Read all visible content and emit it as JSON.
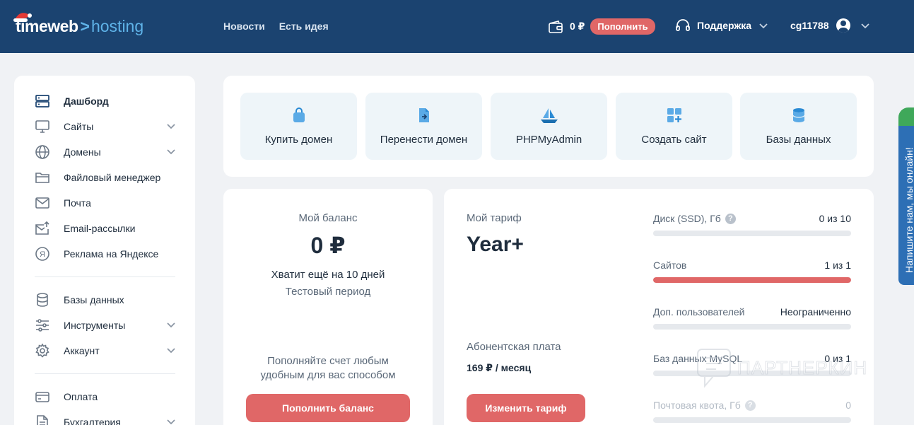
{
  "header": {
    "logo": {
      "brand": "timeweb",
      "separator": ">",
      "product": "hosting"
    },
    "nav": [
      "Новости",
      "Есть идея"
    ],
    "wallet": {
      "balance": "0 ₽",
      "topup_label": "Пополнить"
    },
    "support_label": "Поддержка",
    "username": "cg11788"
  },
  "sidebar": {
    "items": [
      {
        "label": "Дашборд",
        "icon": "server-icon",
        "active": true
      },
      {
        "label": "Сайты",
        "icon": "monitor-icon",
        "expandable": true
      },
      {
        "label": "Домены",
        "icon": "globe-icon",
        "expandable": true
      },
      {
        "label": "Файловый менеджер",
        "icon": "folder-icon"
      },
      {
        "label": "Почта",
        "icon": "mail-icon"
      },
      {
        "label": "Email-рассылки",
        "icon": "mail-send-icon"
      },
      {
        "label": "Реклама на Яндексе",
        "icon": "yandex-icon"
      },
      {
        "label": "Базы данных",
        "icon": "database-icon"
      },
      {
        "label": "Инструменты",
        "icon": "sliders-icon",
        "expandable": true
      },
      {
        "label": "Аккаунт",
        "icon": "gear-icon",
        "expandable": true
      },
      {
        "label": "Оплата",
        "icon": "credit-card-icon"
      },
      {
        "label": "Бухгалтерия",
        "icon": "document-icon",
        "expandable": true
      }
    ]
  },
  "quick_actions": [
    {
      "label": "Купить домен",
      "icon": "shopping-bag-icon"
    },
    {
      "label": "Перенести домен",
      "icon": "file-transfer-icon"
    },
    {
      "label": "PHPMyAdmin",
      "icon": "sailboat-icon"
    },
    {
      "label": "Создать сайт",
      "icon": "add-grid-icon"
    },
    {
      "label": "Базы данных",
      "icon": "database-icon"
    }
  ],
  "balance": {
    "title": "Мой баланс",
    "amount": "0 ₽",
    "days_left": "Хватит ещё на 10 дней",
    "period": "Тестовый период",
    "hint": "Пополняйте счет любым удобным для вас способом",
    "button_label": "Пополнить баланс"
  },
  "tariff": {
    "title": "Мой тариф",
    "name": "Year+",
    "fee_label": "Абонентская плата",
    "fee": "169 ₽ / месяц",
    "button_label": "Изменить тариф",
    "quotas": [
      {
        "label": "Диск (SSD), Гб",
        "value": "0 из 10",
        "fill": 0,
        "help": true
      },
      {
        "label": "Сайтов",
        "value": "1 из 1",
        "fill": 1
      },
      {
        "label": "Доп. пользователей",
        "value": "Неограниченно",
        "fill": 0
      },
      {
        "label": "Баз данных MySQL",
        "value": "0 из 1",
        "fill": 0
      },
      {
        "label": "Почтовая квота, Гб",
        "value": "0",
        "fill": 0,
        "help": true,
        "faded": true
      }
    ]
  },
  "watermark": "ПАРТНЕРКИН",
  "chat_label": "Напишите нам, мы онлайн!",
  "colors": {
    "header": "#1b4370",
    "accent": "#e06767",
    "link": "#5fb3e8",
    "chat": "#2d6fb5"
  }
}
